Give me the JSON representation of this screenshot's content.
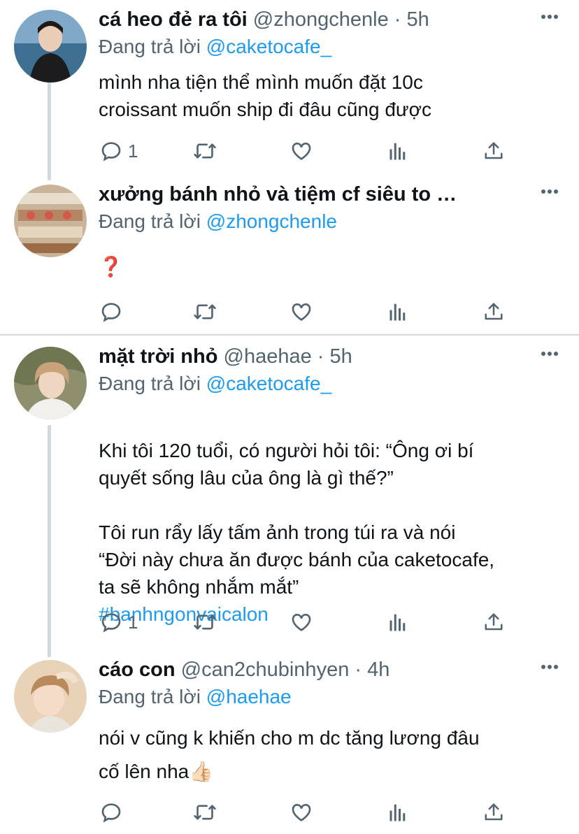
{
  "tweets": [
    {
      "name": "cá heo đẻ ra tôi",
      "handle": "@zhongchenle",
      "separator": "·",
      "time": "5h",
      "replying_prefix": "Đang trả lời",
      "replying_to": "@caketocafe_",
      "text": "mình nha tiện thể mình muốn đặt 10c\ncroissant muốn ship đi đâu cũng được",
      "hashtag": "",
      "reply_count": "1"
    },
    {
      "name": "xưởng bánh nhỏ và tiệm cf siêu to …",
      "handle": "",
      "separator": "",
      "time": "",
      "replying_prefix": "Đang trả lời",
      "replying_to": "@zhongchenle",
      "text": "❓",
      "hashtag": "",
      "reply_count": ""
    },
    {
      "name": "mặt trời nhỏ",
      "handle": "@haehae",
      "separator": "·",
      "time": "5h",
      "replying_prefix": "Đang trả lời",
      "replying_to": "@caketocafe_",
      "text": "Khi tôi 120 tuổi, có người hỏi tôi: “Ông ơi bí\nquyết sống lâu của ông là gì thế?”\n\nTôi run rẩy lấy tấm ảnh trong túi ra và nói\n“Đời này chưa ăn được bánh của caketocafe,\nta sẽ không nhắm mắt”",
      "hashtag": "#banhngonvaicalon",
      "reply_count": "1"
    },
    {
      "name": "cáo con",
      "handle": "@can2chubinhyen",
      "separator": "·",
      "time": "4h",
      "replying_prefix": "Đang trả lời",
      "replying_to": "@haehae",
      "text": "nói v cũng k khiến cho m dc tăng lương đâu\ncố lên nha👍🏻",
      "hashtag": "",
      "reply_count": ""
    }
  ],
  "icons": {
    "reply": "reply-icon",
    "retweet": "retweet-icon",
    "like": "heart-icon",
    "analytics": "analytics-icon",
    "share": "share-icon",
    "more": "more-icon"
  },
  "colors": {
    "link": "#1d9bf0",
    "secondary": "#536471",
    "thread_line": "#cfd9de"
  }
}
